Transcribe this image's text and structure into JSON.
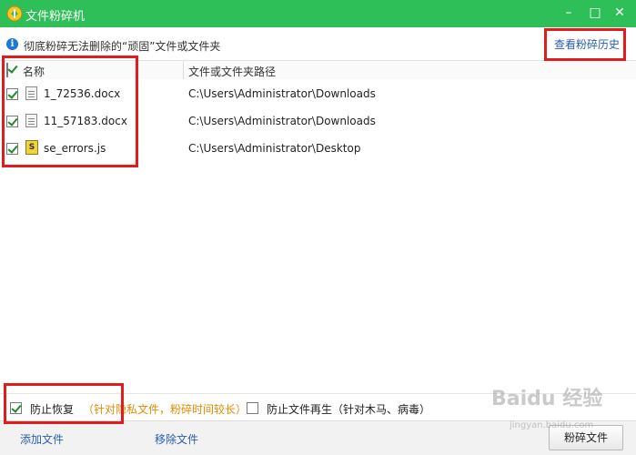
{
  "window": {
    "title": "文件粉碎机",
    "controls": {
      "minimize": "–",
      "maximize": "□",
      "close": "✕"
    }
  },
  "info_bar": {
    "icon": "info-icon",
    "icon_glyph": "i",
    "text": "彻底粉碎无法删除的“顽固”文件或文件夹",
    "history_link": "查看粉碎历史"
  },
  "list": {
    "columns": {
      "name": "名称",
      "path": "文件或文件夹路径"
    },
    "header_checked": true,
    "rows": [
      {
        "checked": true,
        "icon": "document-icon",
        "name": "1_72536.docx",
        "path": "C:\\Users\\Administrator\\Downloads"
      },
      {
        "checked": true,
        "icon": "document-icon",
        "name": "11_57183.docx",
        "path": "C:\\Users\\Administrator\\Downloads"
      },
      {
        "checked": true,
        "icon": "js-file-icon",
        "name": "se_errors.js",
        "path": "C:\\Users\\Administrator\\Desktop"
      }
    ]
  },
  "options": {
    "prevent_recovery": {
      "checked": true,
      "label": "防止恢复",
      "hint": "（针对隐私文件，粉碎时间较长）"
    },
    "prevent_regen": {
      "checked": false,
      "label": "防止文件再生（针对木马、病毒）"
    }
  },
  "footer": {
    "add_file": "添加文件",
    "remove_file": "移除文件",
    "shred_button": "粉碎文件"
  },
  "watermark": {
    "text": "Baidu 经验",
    "sub": "jingyan.baidu.com"
  },
  "colors": {
    "titlebar": "#2fbf58",
    "link": "#2a5db0",
    "hint": "#e58a00",
    "highlight_box": "#e01c1c"
  }
}
